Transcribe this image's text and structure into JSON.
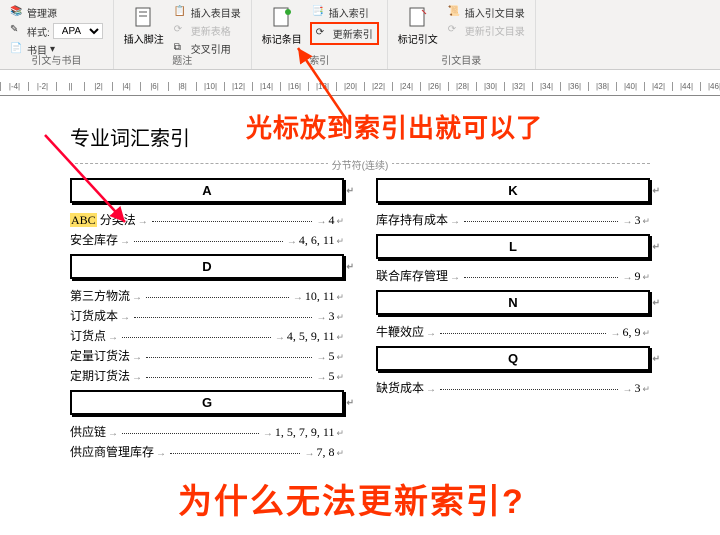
{
  "ribbon": {
    "group1": {
      "manage_sources": "管理源",
      "style_label": "样式:",
      "style_value": "APA",
      "bibliography": "书目",
      "label": "引文与书目"
    },
    "group2": {
      "insert_footnote": "插入脚注",
      "insert_toc": "插入表目录",
      "update_table": "更新表格",
      "cross_ref": "交叉引用",
      "label": "题注"
    },
    "group3": {
      "mark_entry": "标记条目",
      "insert_index": "插入索引",
      "update_index": "更新索引",
      "label": "索引"
    },
    "group4": {
      "mark_citation": "标记引文",
      "insert_toa": "插入引文目录",
      "update_toa": "更新引文目录",
      "label": "引文目录"
    }
  },
  "ruler_marks": [
    "-4",
    "-2",
    "",
    "2",
    "4",
    "6",
    "8",
    "10",
    "12",
    "14",
    "16",
    "18",
    "20",
    "22",
    "24",
    "26",
    "28",
    "30",
    "32",
    "34",
    "36",
    "38",
    "40",
    "42",
    "44",
    "46"
  ],
  "doc": {
    "title": "专业词汇索引",
    "section_break": "分节符(连续)",
    "left": [
      {
        "letter": "A",
        "entries": [
          {
            "term_hl": "ABC",
            "term": " 分类法",
            "page": "4"
          },
          {
            "term": "安全库存",
            "page": "4, 6, 11"
          }
        ]
      },
      {
        "letter": "D",
        "entries": [
          {
            "term": "第三方物流",
            "page": "10, 11"
          },
          {
            "term": "订货成本",
            "page": "3"
          },
          {
            "term": "订货点",
            "page": "4, 5, 9, 11"
          },
          {
            "term": "定量订货法",
            "page": "5"
          },
          {
            "term": "定期订货法",
            "page": "5"
          }
        ]
      },
      {
        "letter": "G",
        "entries": [
          {
            "term": "供应链",
            "page": "1, 5, 7, 9, 11"
          },
          {
            "term": "供应商管理库存",
            "page": "7, 8"
          }
        ]
      }
    ],
    "right": [
      {
        "letter": "K",
        "entries": [
          {
            "term": "库存持有成本",
            "page": "3"
          }
        ]
      },
      {
        "letter": "L",
        "entries": [
          {
            "term": "联合库存管理",
            "page": "9"
          }
        ]
      },
      {
        "letter": "N",
        "entries": [
          {
            "term": "牛鞭效应",
            "page": "6, 9"
          }
        ]
      },
      {
        "letter": "Q",
        "entries": [
          {
            "term": "缺货成本",
            "page": "3"
          }
        ]
      }
    ]
  },
  "annotations": {
    "top": "光标放到索引出就可以了",
    "bottom": "为什么无法更新索引?"
  }
}
